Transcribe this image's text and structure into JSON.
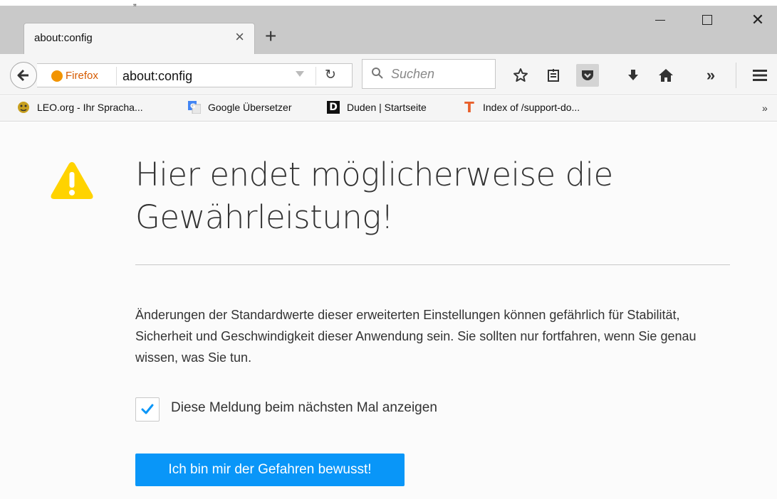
{
  "window": {
    "stray_mark": "„"
  },
  "tab": {
    "title": "about:config",
    "close_glyph": "×",
    "new_tab_glyph": "+"
  },
  "window_controls": {
    "close_glyph": "✕"
  },
  "navbar": {
    "identity_label": "Firefox",
    "url": "about:config",
    "reload_glyph": "↻",
    "search_placeholder": "Suchen",
    "overflow_glyph": "»"
  },
  "bookmarks": {
    "items": [
      {
        "label": "LEO.org - Ihr Spracha...",
        "icon": "leo-favicon"
      },
      {
        "label": "Google Übersetzer",
        "icon": "google-translate-favicon"
      },
      {
        "label": "Duden | Startseite",
        "icon": "duden-favicon",
        "icon_text": "D"
      },
      {
        "label": "Index of /support-do...",
        "icon": "t-favicon",
        "icon_text": "T"
      }
    ],
    "overflow_glyph": "»"
  },
  "content": {
    "title": "Hier endet möglicherweise die Gewährleistung!",
    "warning_text": "Änderungen der Standardwerte dieser erweiterten Einstellungen können gefährlich für Stabilität, Sicherheit und Geschwindigkeit dieser Anwendung sein. Sie sollten nur fortfahren, wenn Sie genau wissen, was Sie tun.",
    "checkbox_label": "Diese Meldung beim nächsten Mal anzeigen",
    "checkbox_checked": true,
    "button_label": "Ich bin mir der Gefahren bewusst!"
  },
  "colors": {
    "accent_button": "#0996f8",
    "warning_icon": "#ffd300",
    "identity": "#d65a00"
  }
}
